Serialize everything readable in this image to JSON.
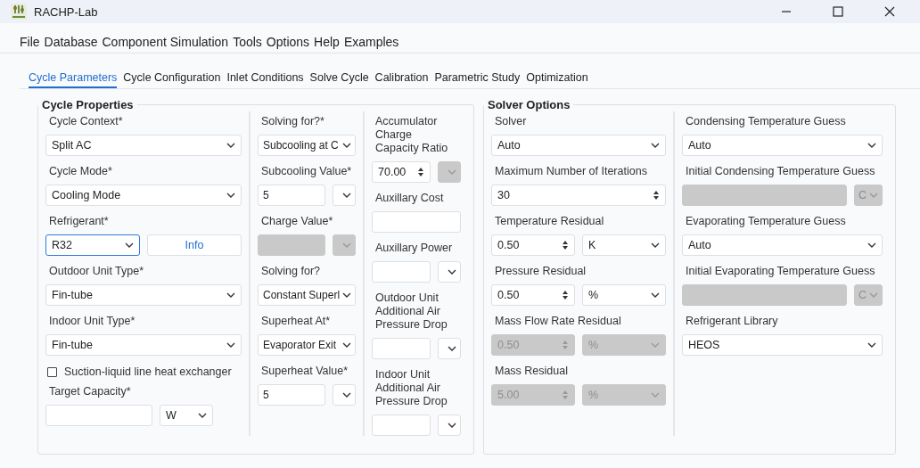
{
  "window": {
    "title": "RACHP-Lab"
  },
  "menu": [
    "File",
    "Database",
    "Component Simulation",
    "Tools",
    "Options",
    "Help",
    "Examples"
  ],
  "tabs": [
    {
      "label": "Cycle Parameters",
      "selected": true
    },
    {
      "label": "Cycle Configuration",
      "selected": false
    },
    {
      "label": "Inlet Conditions",
      "selected": false
    },
    {
      "label": "Solve Cycle",
      "selected": false
    },
    {
      "label": "Calibration",
      "selected": false
    },
    {
      "label": "Parametric Study",
      "selected": false
    },
    {
      "label": "Optimization",
      "selected": false
    }
  ],
  "groups": [
    {
      "title": "Cycle Properties",
      "columns": [
        [
          {
            "kind": "label",
            "text": "Cycle Context*"
          },
          {
            "kind": "controls",
            "controls": [
              {
                "kind": "select",
                "value": "Split AC",
                "disabled": false,
                "focused": false
              }
            ]
          },
          {
            "kind": "label",
            "text": "Cycle Mode*"
          },
          {
            "kind": "controls",
            "controls": [
              {
                "kind": "select",
                "value": "Cooling Mode",
                "disabled": false,
                "focused": false
              }
            ]
          },
          {
            "kind": "label",
            "text": "Refrigerant*"
          },
          {
            "kind": "controls",
            "controls": [
              {
                "kind": "select",
                "value": "R32",
                "disabled": false,
                "focused": true
              },
              {
                "kind": "button",
                "value": "Info",
                "disabled": false,
                "focused": false
              }
            ]
          },
          {
            "kind": "label",
            "text": "Outdoor Unit Type*"
          },
          {
            "kind": "controls",
            "controls": [
              {
                "kind": "select",
                "value": "Fin-tube",
                "disabled": false,
                "focused": false
              }
            ]
          },
          {
            "kind": "label",
            "text": "Indoor Unit Type*"
          },
          {
            "kind": "controls",
            "controls": [
              {
                "kind": "select",
                "value": "Fin-tube",
                "disabled": false,
                "focused": false
              }
            ]
          },
          {
            "kind": "checkbox",
            "text": "Suction-liquid line heat exchanger",
            "checked": false
          },
          {
            "kind": "label",
            "text": "Target Capacity*"
          },
          {
            "kind": "controls",
            "controls": [
              {
                "kind": "input",
                "disabled": false,
                "focused": false
              },
              {
                "kind": "unit",
                "value": "W",
                "disabled": false,
                "focused": false
              }
            ]
          }
        ],
        [
          {
            "kind": "label",
            "text": "Solving for?*"
          },
          {
            "kind": "controls",
            "controls": [
              {
                "kind": "select",
                "value": "Subcooling at C",
                "disabled": false,
                "focused": false
              }
            ]
          },
          {
            "kind": "label",
            "text": "Subcooling Value*"
          },
          {
            "kind": "controls",
            "controls": [
              {
                "kind": "input",
                "value": "5",
                "disabled": false,
                "focused": false
              },
              {
                "kind": "unit",
                "disabled": false,
                "focused": false
              }
            ]
          },
          {
            "kind": "label",
            "text": "Charge Value*"
          },
          {
            "kind": "controls",
            "controls": [
              {
                "kind": "input",
                "disabled": true,
                "focused": false
              },
              {
                "kind": "unit",
                "disabled": true,
                "focused": false
              }
            ]
          },
          {
            "kind": "label",
            "text": "Solving for?"
          },
          {
            "kind": "controls",
            "controls": [
              {
                "kind": "select",
                "value": "Constant Superl",
                "disabled": false,
                "focused": false
              }
            ]
          },
          {
            "kind": "label",
            "text": "Superheat At*"
          },
          {
            "kind": "controls",
            "controls": [
              {
                "kind": "select",
                "value": "Evaporator Exit",
                "disabled": false,
                "focused": false
              }
            ]
          },
          {
            "kind": "label",
            "text": "Superheat Value*"
          },
          {
            "kind": "controls",
            "controls": [
              {
                "kind": "input",
                "value": "5",
                "disabled": false,
                "focused": false
              },
              {
                "kind": "unit",
                "disabled": false,
                "focused": false
              }
            ]
          }
        ],
        [
          {
            "kind": "label",
            "text": "Accumulator Charge Capacity Ratio"
          },
          {
            "kind": "controls",
            "controls": [
              {
                "kind": "spin",
                "value": "70.00",
                "disabled": false,
                "focused": false
              },
              {
                "kind": "unit",
                "disabled": true,
                "focused": false
              }
            ]
          },
          {
            "kind": "label",
            "text": "Auxillary Cost"
          },
          {
            "kind": "controls",
            "controls": [
              {
                "kind": "input",
                "disabled": false,
                "focused": false
              }
            ]
          },
          {
            "kind": "label",
            "text": "Auxillary Power"
          },
          {
            "kind": "controls",
            "controls": [
              {
                "kind": "input",
                "disabled": false,
                "focused": false
              },
              {
                "kind": "unit",
                "disabled": false,
                "focused": false
              }
            ]
          },
          {
            "kind": "label",
            "text": "Outdoor Unit Additional Air Pressure Drop"
          },
          {
            "kind": "controls",
            "controls": [
              {
                "kind": "input",
                "disabled": false,
                "focused": false
              },
              {
                "kind": "unit",
                "disabled": false,
                "focused": false
              }
            ]
          },
          {
            "kind": "label",
            "text": "Indoor Unit Additional Air Pressure Drop"
          },
          {
            "kind": "controls",
            "controls": [
              {
                "kind": "input",
                "disabled": false,
                "focused": false
              },
              {
                "kind": "unit",
                "disabled": false,
                "focused": false
              }
            ]
          }
        ]
      ]
    },
    {
      "title": "Solver Options",
      "columns": [
        [
          {
            "kind": "label",
            "text": "Solver"
          },
          {
            "kind": "controls",
            "controls": [
              {
                "kind": "select",
                "value": "Auto",
                "disabled": false,
                "focused": false
              }
            ]
          },
          {
            "kind": "label",
            "text": "Maximum Number of Iterations"
          },
          {
            "kind": "controls",
            "controls": [
              {
                "kind": "spin",
                "value": "30",
                "disabled": false,
                "focused": false
              }
            ]
          },
          {
            "kind": "label",
            "text": "Temperature Residual"
          },
          {
            "kind": "controls",
            "controls": [
              {
                "kind": "spin",
                "value": "0.50",
                "disabled": false,
                "focused": false
              },
              {
                "kind": "unit",
                "value": "K",
                "disabled": false,
                "focused": false
              }
            ]
          },
          {
            "kind": "label",
            "text": "Pressure Residual"
          },
          {
            "kind": "controls",
            "controls": [
              {
                "kind": "spin",
                "value": "0.50",
                "disabled": false,
                "focused": false
              },
              {
                "kind": "unit",
                "value": "%",
                "disabled": false,
                "focused": false
              }
            ]
          },
          {
            "kind": "label",
            "text": "Mass Flow Rate Residual"
          },
          {
            "kind": "controls",
            "controls": [
              {
                "kind": "spin",
                "value": "0.50",
                "disabled": true,
                "focused": false
              },
              {
                "kind": "unit",
                "value": "%",
                "disabled": true,
                "focused": false
              }
            ]
          },
          {
            "kind": "label",
            "text": "Mass Residual"
          },
          {
            "kind": "controls",
            "controls": [
              {
                "kind": "spin",
                "value": "5.00",
                "disabled": true,
                "focused": false
              },
              {
                "kind": "unit",
                "value": "%",
                "disabled": true,
                "focused": false
              }
            ]
          }
        ],
        [
          {
            "kind": "label",
            "text": "Condensing Temperature Guess"
          },
          {
            "kind": "controls",
            "controls": [
              {
                "kind": "select",
                "value": "Auto",
                "disabled": false,
                "focused": false
              }
            ]
          },
          {
            "kind": "label",
            "text": "Initial Condensing Temperature Guess"
          },
          {
            "kind": "controls",
            "controls": [
              {
                "kind": "input",
                "disabled": true,
                "focused": false
              },
              {
                "kind": "unit",
                "value": "C",
                "disabled": true,
                "focused": false
              }
            ]
          },
          {
            "kind": "label",
            "text": "Evaporating Temperature Guess"
          },
          {
            "kind": "controls",
            "controls": [
              {
                "kind": "select",
                "value": "Auto",
                "disabled": false,
                "focused": false
              }
            ]
          },
          {
            "kind": "label",
            "text": "Initial Evaporating Temperature Guess"
          },
          {
            "kind": "controls",
            "controls": [
              {
                "kind": "input",
                "disabled": true,
                "focused": false
              },
              {
                "kind": "unit",
                "value": "C",
                "disabled": true,
                "focused": false
              }
            ]
          },
          {
            "kind": "label",
            "text": "Refrigerant Library"
          },
          {
            "kind": "controls",
            "controls": [
              {
                "kind": "select",
                "value": "HEOS",
                "disabled": false,
                "focused": false
              }
            ]
          }
        ]
      ]
    }
  ]
}
